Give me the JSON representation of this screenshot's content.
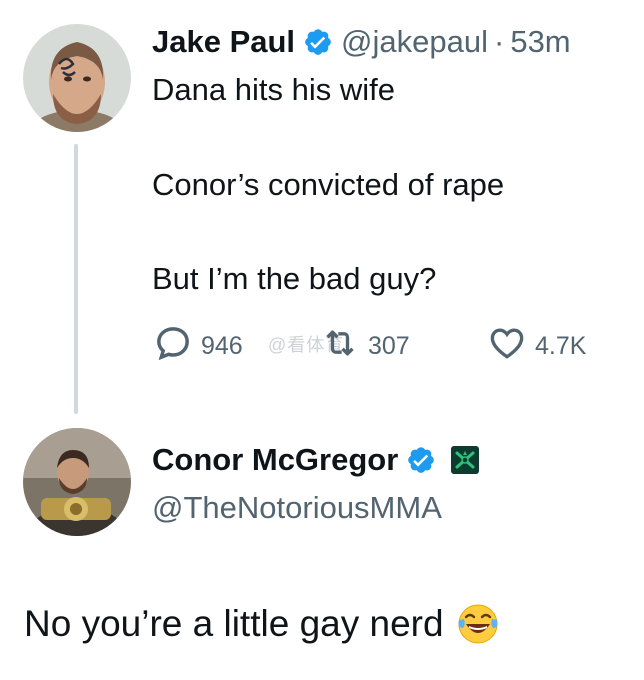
{
  "tweet": {
    "author_name": "Jake Paul",
    "author_handle": "@jakepaul",
    "separator": "·",
    "time": "53m",
    "lines": [
      "Dana hits his wife",
      "Conor’s convicted of rape",
      "But I’m the bad guy?"
    ],
    "replies": "946",
    "retweets": "307",
    "likes": "4.7K",
    "watermark": "@看体育"
  },
  "reply": {
    "author_name": "Conor McGregor",
    "author_handle": "@TheNotoriousMMA",
    "text": "No you’re a little gay nerd",
    "emoji": "face-with-tears-of-joy"
  },
  "colors": {
    "verified_blue": "#1d9bf0",
    "secondary_text": "#536471",
    "thread_line": "#cfd9de",
    "badge_green": "#0d3b2e"
  }
}
